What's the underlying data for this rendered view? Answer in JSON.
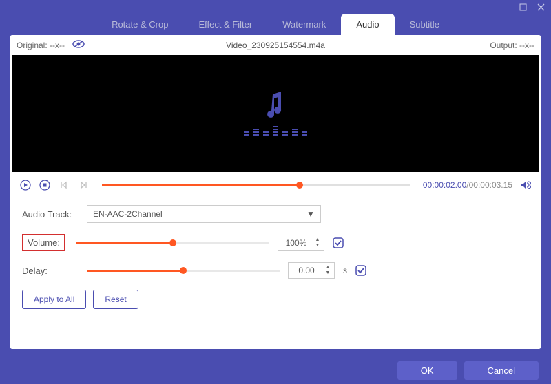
{
  "titlebar": {
    "minimize": "□",
    "close": "✕"
  },
  "tabs": {
    "items": [
      {
        "label": "Rotate & Crop"
      },
      {
        "label": "Effect & Filter"
      },
      {
        "label": "Watermark"
      },
      {
        "label": "Audio"
      },
      {
        "label": "Subtitle"
      }
    ],
    "activeIndex": 3
  },
  "infobar": {
    "original_label": "Original:  --x--",
    "filename": "Video_230925154554.m4a",
    "output_label": "Output:  --x--"
  },
  "playback": {
    "current_time": "00:00:02.00",
    "total_time": "/00:00:03.15",
    "progress_pct": 64
  },
  "settings": {
    "audio_track_label": "Audio Track:",
    "audio_track_value": "EN-AAC-2Channel",
    "volume_label": "Volume:",
    "volume_value": "100%",
    "delay_label": "Delay:",
    "delay_value": "0.00",
    "delay_unit": "s",
    "apply_all": "Apply to All",
    "reset": "Reset"
  },
  "footer": {
    "ok": "OK",
    "cancel": "Cancel"
  }
}
